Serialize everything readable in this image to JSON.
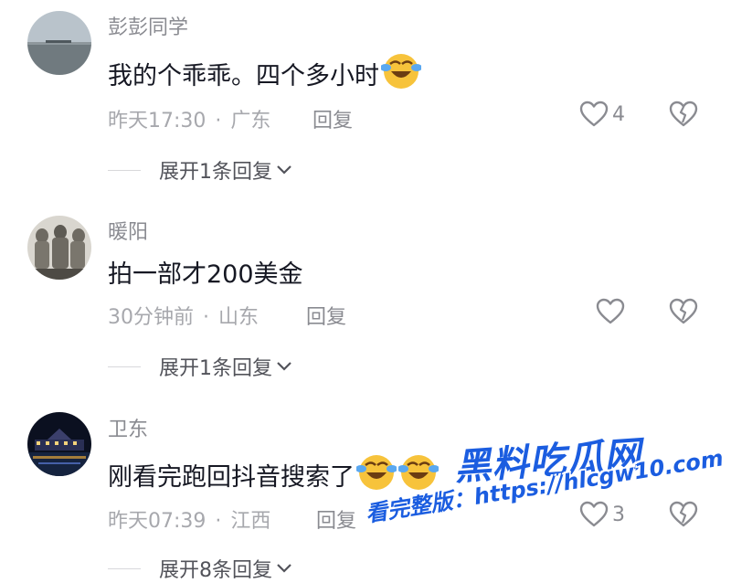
{
  "colors": {
    "text": "#161823",
    "secondary": "#a7a8ad",
    "username": "#8a8b91",
    "watermark": "#1b5de0"
  },
  "comments": [
    {
      "username": "彭彭同学",
      "text": "我的个乖乖。四个多小时",
      "emoji": "crying-laughing-face",
      "time": "昨天17:30",
      "location": "广东",
      "reply_label": "回复",
      "likes": "4",
      "expand_label": "展开1条回复",
      "avatar": "sea-horizon-photo"
    },
    {
      "username": "暖阳",
      "text": "拍一部才200美金",
      "emoji": "",
      "time": "30分钟前",
      "location": "山东",
      "reply_label": "回复",
      "likes": "",
      "expand_label": "展开1条回复",
      "avatar": "stone-statues-photo"
    },
    {
      "username": "卫东",
      "text": "刚看完跑回抖音搜索了",
      "emoji": "crying-laughing-face",
      "time": "昨天07:39",
      "location": "江西",
      "reply_label": "回复",
      "likes": "3",
      "expand_label": "展开8条回复",
      "avatar": "night-city-lights-photo"
    }
  ],
  "watermark": {
    "brand": "黑料吃瓜网",
    "url_line": "看完整版：https://hlcgw10.com"
  }
}
